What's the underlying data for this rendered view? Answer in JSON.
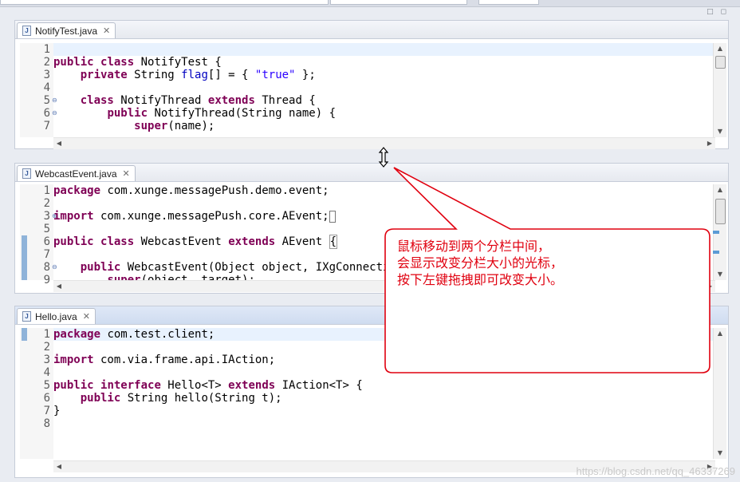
{
  "window": {
    "min_max_controls": "□ ◻"
  },
  "editors": [
    {
      "tab_label": "NotifyTest.java",
      "tab_close": "✕",
      "line_numbers": [
        "1",
        "2",
        "3",
        "4",
        "5",
        "6",
        "7"
      ],
      "lines": [
        "",
        "public class NotifyTest {",
        "    private String flag[] = { \"true\" };",
        "",
        "    class NotifyThread extends Thread {",
        "        public NotifyThread(String name) {",
        "            super(name);"
      ]
    },
    {
      "tab_label": "WebcastEvent.java",
      "tab_close": "✕",
      "line_numbers": [
        "1",
        "2",
        "3",
        "5",
        "6",
        "7",
        "8",
        "9"
      ],
      "lines": [
        "package com.xunge.messagePush.demo.event;",
        "",
        "import com.xunge.messagePush.core.AEvent;",
        "",
        "public class WebcastEvent extends AEvent {",
        "",
        "    public WebcastEvent(Object object, IXgConnectio",
        "        super(object, target);"
      ]
    },
    {
      "tab_label": "Hello.java",
      "tab_close": "✕",
      "line_numbers": [
        "1",
        "2",
        "3",
        "4",
        "5",
        "6",
        "7",
        "8"
      ],
      "lines": [
        "package com.test.client;",
        "",
        "import com.via.frame.api.IAction;",
        "",
        "public interface Hello<T> extends IAction<T> {",
        "    public String hello(String t);",
        "}",
        ""
      ]
    }
  ],
  "callout": {
    "lines": [
      "鼠标移动到两个分栏中间，",
      "会显示改变分栏大小的光标，",
      "按下左键拖拽即可改变大小。"
    ],
    "color": "#e0000f"
  },
  "watermark": "https://blog.csdn.net/qq_46337269",
  "colors": {
    "keyword": "#7f0055",
    "string": "#2a00ff",
    "field": "#0000c0",
    "current_line": "#e8f2fe"
  }
}
